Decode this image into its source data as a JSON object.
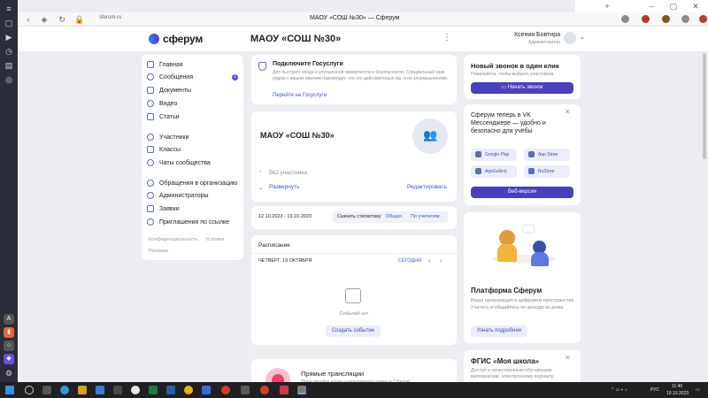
{
  "browser": {
    "url": "sferum.ru",
    "tab_title": "МАОУ «СОШ №30» — Сферум"
  },
  "header": {
    "logo_text": "сферум",
    "org_title": "МАОУ «СОШ №30»",
    "user_name": "Ксения Бовтира",
    "user_role": "Администратор"
  },
  "sidebar": {
    "items": [
      {
        "label": "Главная"
      },
      {
        "label": "Сообщения",
        "badge": "1"
      },
      {
        "label": "Документы"
      },
      {
        "label": "Видео"
      },
      {
        "label": "Статьи"
      },
      {
        "label": "Участники"
      },
      {
        "label": "Классы"
      },
      {
        "label": "Чаты сообщества"
      },
      {
        "label": "Обращения в организацию"
      },
      {
        "label": "Администраторы"
      },
      {
        "label": "Заявки"
      },
      {
        "label": "Приглашения по ссылке"
      }
    ],
    "footer_privacy": "Конфиденциальность",
    "footer_terms": "Условия",
    "footer_ads": "Реклама"
  },
  "gosuslugi": {
    "title": "Подключите Госуслуги",
    "body": "Для быстрого входа и улучшенной приватности и безопасности. Специальный знак рядом с вашим именем подтвердит, что это действительно вы, а не злоумышленник.",
    "link": "Перейти на Госуслуги"
  },
  "org_card": {
    "title": "МАОУ «СОШ №30»",
    "members": "562 участника",
    "expand": "Развернуть",
    "edit": "Редактировать"
  },
  "stats": {
    "range": "12.10.2023 - 19.10.2023",
    "download": "Скачать статистику",
    "general": "Общая",
    "teachers": "По учителям"
  },
  "schedule": {
    "title": "Расписание",
    "date": "ЧЕТВЕРГ, 19 ОКТЯБРЯ",
    "today": "СЕГОДНЯ",
    "empty": "Событий нет",
    "create": "Создать событие"
  },
  "broadcast": {
    "title": "Прямые трансляции",
    "text": "Транслируйте уроки и мероприятия прямо в Сферум"
  },
  "call": {
    "title": "Новый звонок в один клик",
    "subtitle": "Пожалуйста, чтобы выбрать участников",
    "button": "Начать звонок"
  },
  "vk_messenger": {
    "title": "Сферум теперь в VK Мессенджере — удобно и безопасно для учёбы",
    "stores": [
      "Google Play",
      "App Store",
      "AppGallery",
      "RuStore"
    ],
    "web": "Веб-версия"
  },
  "platform": {
    "title": "Платформа Сферум",
    "text": "Ваша организация в цифровом пространстве. Учитесь и общайтесь не выходя из дома.",
    "button": "Узнать подробнее"
  },
  "fgis": {
    "title": "ФГИС «Моя школа»",
    "text": "Доступ к качественным обучающим материалам, электронному журналу"
  },
  "taskbar": {
    "lang": "РУС",
    "time": "11:40",
    "date": "19.10.2023"
  },
  "colors": {
    "accent": "#4a3fbf",
    "link": "#3e59c8",
    "background": "#ebedf0"
  }
}
